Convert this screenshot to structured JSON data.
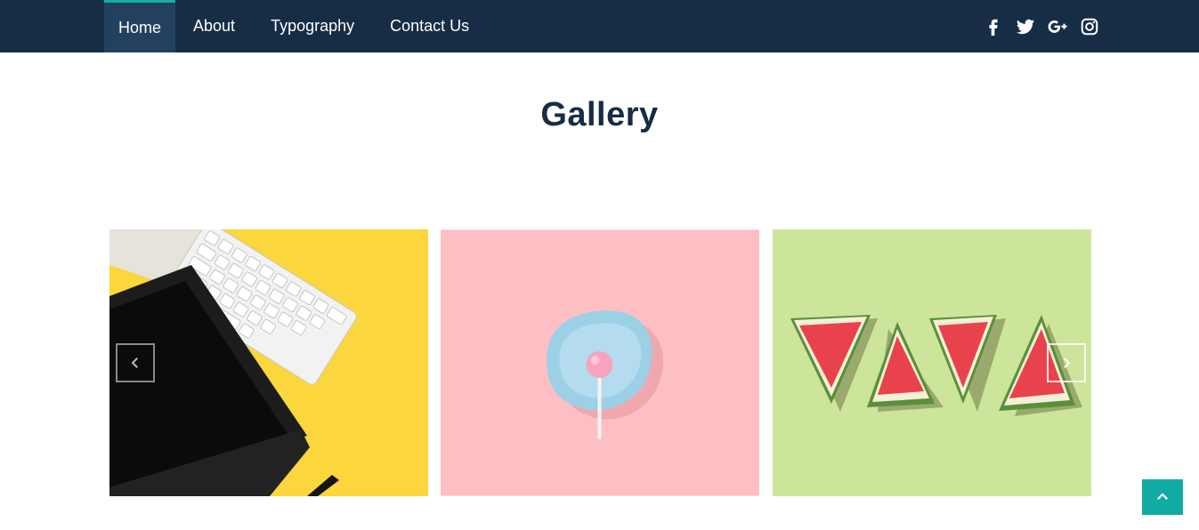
{
  "nav": {
    "items": [
      {
        "label": "Home",
        "active": true
      },
      {
        "label": "About",
        "active": false
      },
      {
        "label": "Typography",
        "active": false
      },
      {
        "label": "Contact Us",
        "active": false
      }
    ],
    "social": [
      "facebook-icon",
      "twitter-icon",
      "google-plus-icon",
      "instagram-icon"
    ]
  },
  "page": {
    "title": "Gallery"
  },
  "gallery": {
    "slides": [
      {
        "subject": "keyboard and tablet on yellow background",
        "background": "#fbd63c"
      },
      {
        "subject": "pink lollipop on blue plate",
        "background": "#fdbfc4"
      },
      {
        "subject": "watermelon slices on green background",
        "background": "#cde59a"
      }
    ],
    "prev_icon": "chevron-left-icon",
    "next_icon": "chevron-right-icon"
  },
  "back_to_top": {
    "icon": "chevron-up-icon"
  },
  "colors": {
    "navbar": "#172d45",
    "nav_active": "#23415f",
    "accent": "#14b0a6",
    "title": "#172d45"
  }
}
